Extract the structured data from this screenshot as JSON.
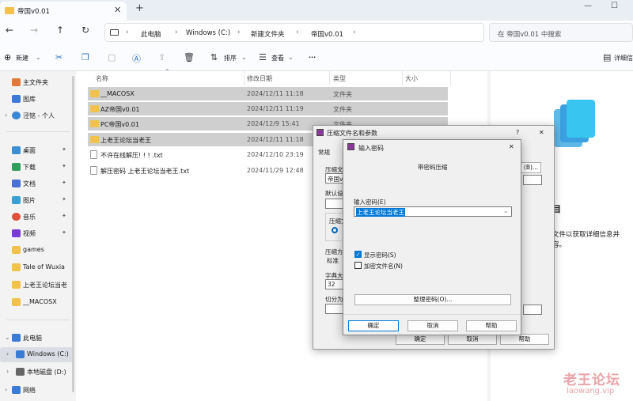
{
  "window": {
    "tab_title": "帝国v0.01",
    "tab_close": "✕",
    "tab_add": "+",
    "min": "—",
    "max": "☐"
  },
  "nav": {
    "back": "←",
    "forward": "→",
    "up": "↑",
    "refresh": "↻"
  },
  "breadcrumb": [
    "此电脑",
    "Windows (C:)",
    "新建文件夹",
    "帝国v0.01"
  ],
  "breadcrumb_sep": "›",
  "search_placeholder": "在 帝国v0.01 中搜索",
  "toolbar": {
    "new": "新建",
    "sort": "排序",
    "view": "查看",
    "more": "···",
    "details": "详细信"
  },
  "sidebar": {
    "quick": [
      {
        "label": "主文件夹",
        "color": "#e07a3a"
      },
      {
        "label": "图库",
        "color": "#3a7bd5"
      },
      {
        "label": "泾铭 - 个人",
        "color": "#3a88d5"
      }
    ],
    "pinned": [
      {
        "label": "桌面",
        "color": "#3a8fd5"
      },
      {
        "label": "下载",
        "color": "#2e9e5b"
      },
      {
        "label": "文档",
        "color": "#4a6fd5"
      },
      {
        "label": "图片",
        "color": "#3aa0d5"
      },
      {
        "label": "音乐",
        "color": "#e0503a"
      },
      {
        "label": "视频",
        "color": "#7a3ad5"
      },
      {
        "label": "games",
        "color": "#f2c14e"
      },
      {
        "label": "Tale of Wuxia",
        "color": "#f2c14e"
      },
      {
        "label": "上老王论坛当老",
        "color": "#f2c14e"
      },
      {
        "label": "__MACOSX",
        "color": "#f2c14e"
      }
    ],
    "pin_glyph": "📌",
    "drives": [
      {
        "label": "此电脑",
        "color": "#3a7bd5"
      },
      {
        "label": "Windows (C:)",
        "color": "#3a7bd5"
      },
      {
        "label": "本地磁盘 (D:)",
        "color": "#666666"
      },
      {
        "label": "网络",
        "color": "#3a7bd5"
      }
    ]
  },
  "columns": {
    "name": "名称",
    "date": "修改日期",
    "type": "类型",
    "size": "大小"
  },
  "files": [
    {
      "name": "__MACOSX",
      "date": "2024/12/11 11:18",
      "type": "文件夹",
      "kind": "folder",
      "selected": true
    },
    {
      "name": "AZ帝国v0.01",
      "date": "2024/12/11 11:19",
      "type": "文件夹",
      "kind": "folder",
      "selected": true
    },
    {
      "name": "PC帝国v0.01",
      "date": "2024/12/9 15:41",
      "type": "文件夹",
      "kind": "folder",
      "selected": true
    },
    {
      "name": "上老王论坛当老王",
      "date": "2024/12/11 11:18",
      "type": "文件夹",
      "kind": "folder",
      "selected": true
    },
    {
      "name": "不许在线解压! ! ! .txt",
      "date": "2024/12/10 23:19",
      "type": "",
      "kind": "txt",
      "selected": false
    },
    {
      "name": "解压密码 上老王论坛当老王.txt",
      "date": "2024/11/29 12:48",
      "type": "",
      "kind": "txt",
      "selected": false
    }
  ],
  "detail_pane": {
    "heading": "目",
    "text1": "文件以获取详细信息并",
    "text2": "容。"
  },
  "archive_dialog": {
    "title": "压缩文件名和参数",
    "help": "?",
    "close": "✕",
    "tab_general": "常规",
    "archive_name_label": "压缩文",
    "archive_name_value": "帝国v0",
    "browse": "(B)...",
    "profile_label": "默认设",
    "format_label": "压缩文",
    "method_label": "压缩方",
    "method_value": "标准",
    "dict_label": "字典大小",
    "dict_value": "32",
    "split_label": "切分为分",
    "ok": "确定",
    "cancel": "取消",
    "help_btn": "帮助"
  },
  "password_dialog": {
    "title": "输入密码",
    "close": "✕",
    "subtitle": "带密码压缩",
    "password_label": "输入密码(E)",
    "password_value": "上老王论坛当老王",
    "show_password": "显示密码(S)",
    "encrypt_names": "加密文件名(N)",
    "organize": "整理密码(O)...",
    "ok": "确定",
    "cancel": "取消",
    "help": "帮助",
    "show_password_checked": true,
    "encrypt_names_checked": false
  },
  "watermark": {
    "line1": "老王论坛",
    "line2": "laowang.vip"
  }
}
